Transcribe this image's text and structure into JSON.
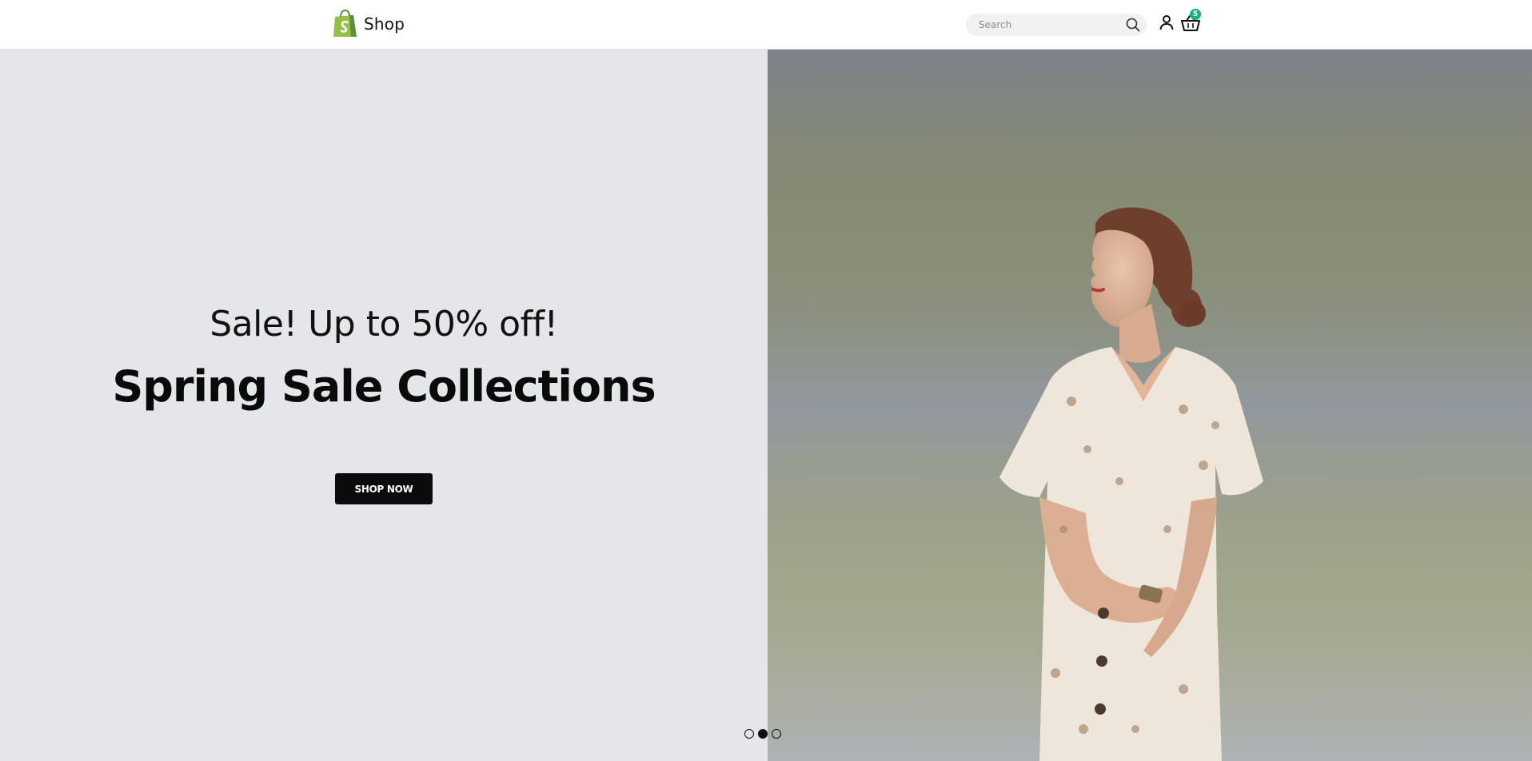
{
  "header": {
    "logo_text": "Shop",
    "search": {
      "placeholder": "Search",
      "value": ""
    },
    "cart": {
      "count": "5"
    }
  },
  "hero": {
    "subtitle": "Sale! Up to 50% off!",
    "title": "Spring Sale Collections",
    "cta_label": "SHOP NOW"
  },
  "carousel": {
    "slides": 3,
    "active_index": 1
  },
  "colors": {
    "brand_green": "#95bf47",
    "badge": "#13b386",
    "hero_bg": "#e5e6ea",
    "button": "#0b0b0d"
  },
  "icons": {
    "logo": "shopping-bag-icon",
    "search": "search-icon",
    "user": "user-icon",
    "cart": "basket-icon"
  }
}
